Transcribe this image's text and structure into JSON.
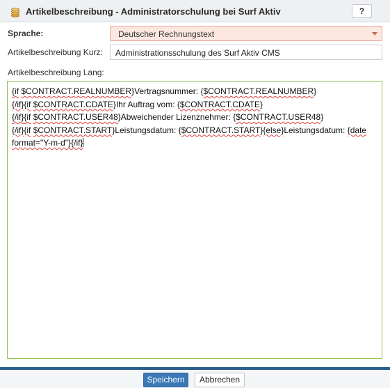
{
  "dialog": {
    "title": "Artikelbeschreibung - Administratorschulung bei Surf Aktiv",
    "help_label": "?",
    "icon": "coins-stack-icon"
  },
  "fields": {
    "sprache_label": "Sprache:",
    "sprache_value": "Deutscher Rechnungstext",
    "kurz_label": "Artikelbeschreibung Kurz:",
    "kurz_value": "Administrationsschulung des Surf Aktiv CMS",
    "lang_label": "Artikelbeschreibung Lang:",
    "lang_lines": [
      "{if $CONTRACT.REALNUMBER}Vertragsnummer: {$CONTRACT.REALNUMBER}",
      "{/if}{if $CONTRACT.CDATE}Ihr Auftrag vom: {$CONTRACT.CDATE}",
      "{/if}{if $CONTRACT.USER48}Abweichender Lizenznehmer: {$CONTRACT.USER48}",
      "{/if}{if $CONTRACT.START}Leistungsdatum: {$CONTRACT.START}{else}Leistungsdatum: {date",
      "format=\"Y-m-d\"}{/if}"
    ]
  },
  "buttons": {
    "save_label": "Speichern",
    "cancel_label": "Abbrechen"
  },
  "colors": {
    "primary_button": "#3a78b6",
    "select_background": "#fde8e1",
    "textarea_border": "#8bc34a",
    "footer_bar": "#2c5d8c"
  }
}
